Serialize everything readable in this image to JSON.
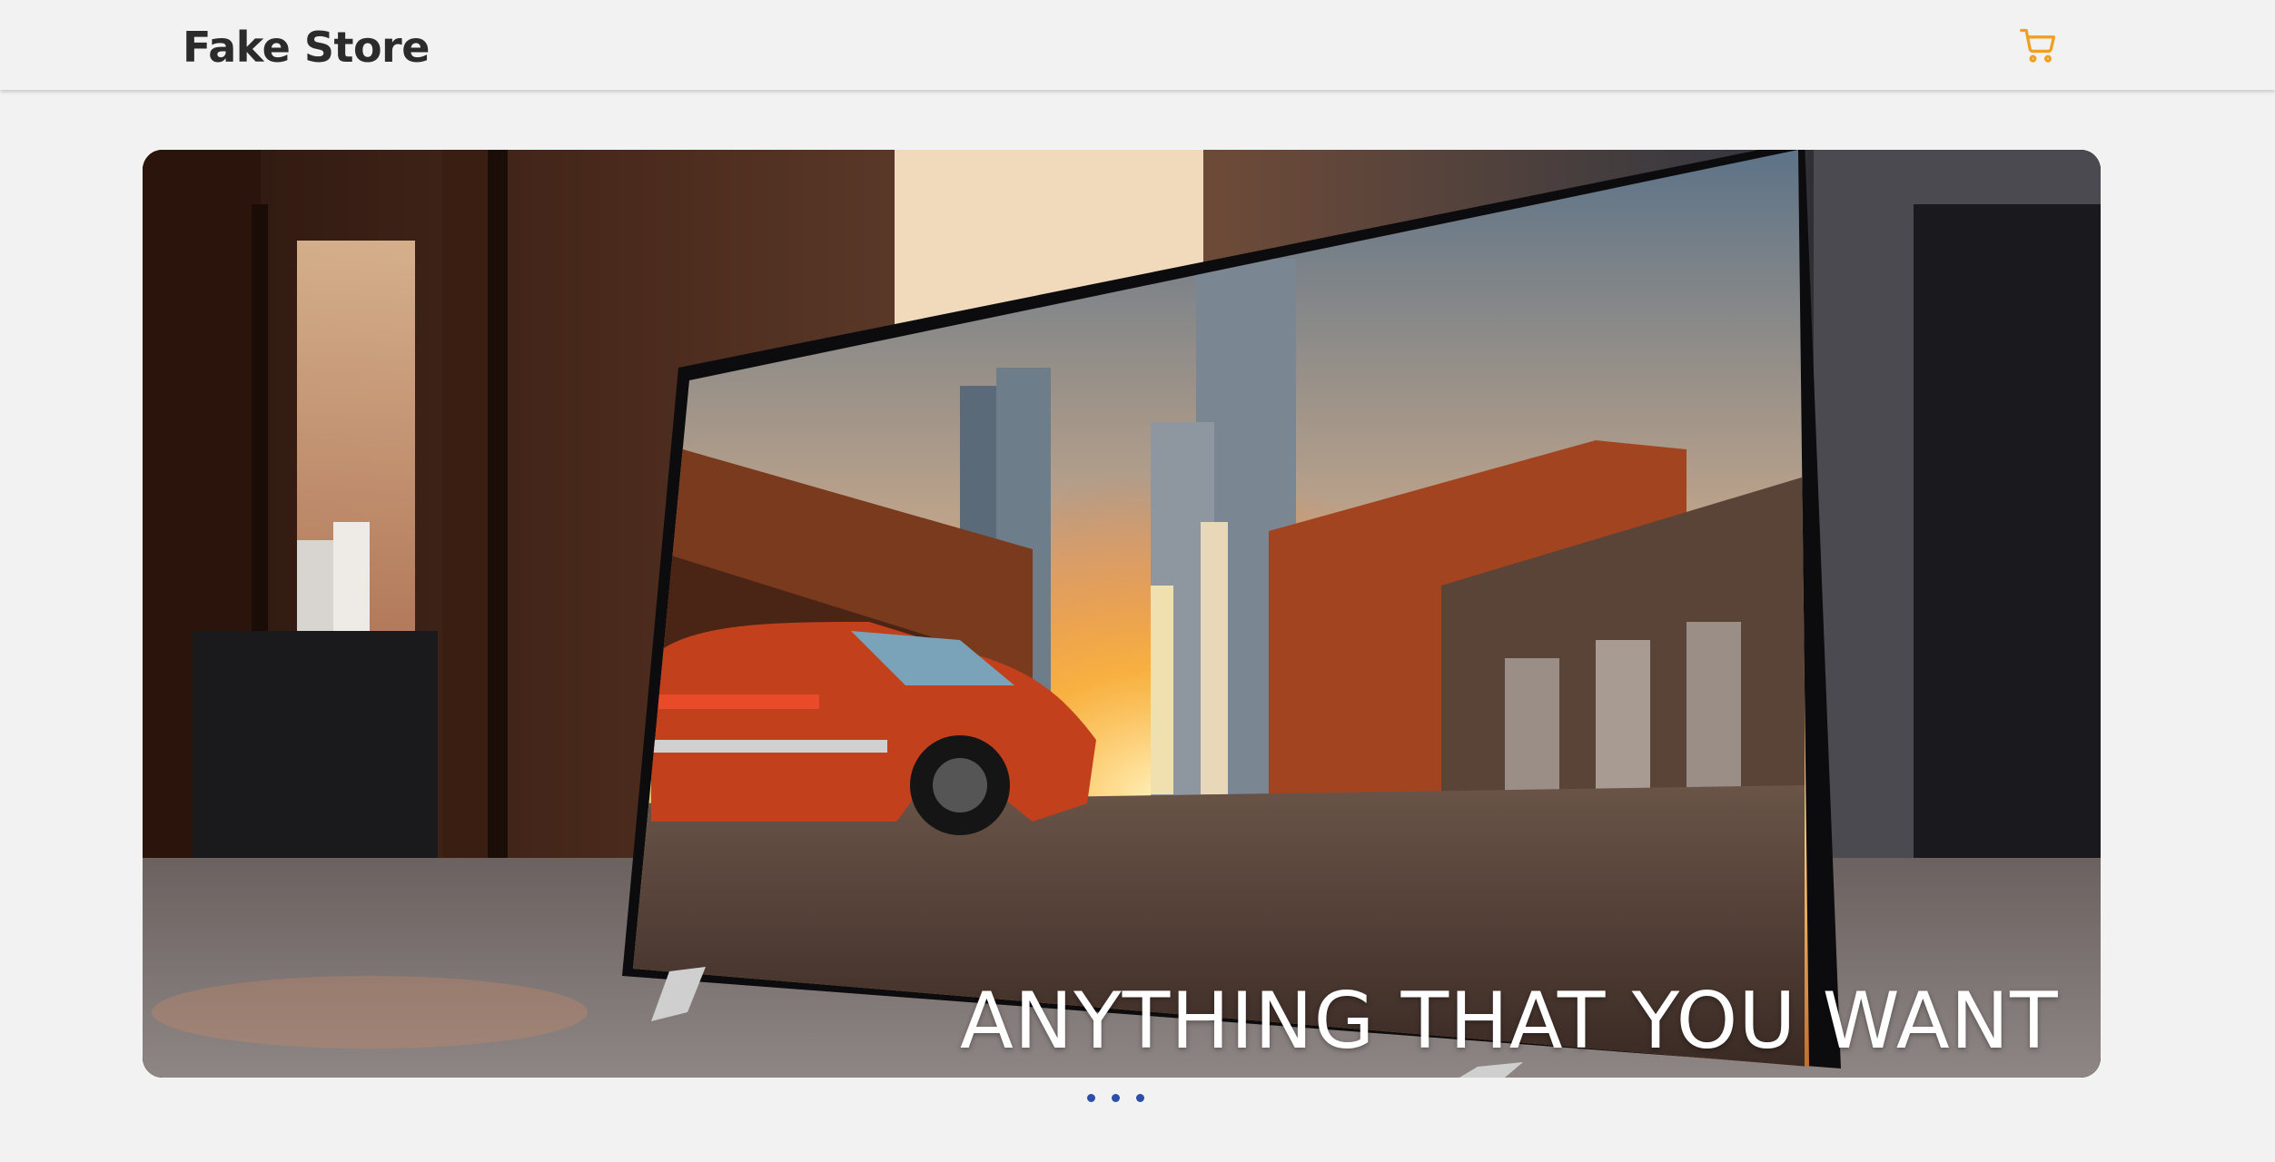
{
  "navbar": {
    "brand": "Fake Store",
    "cart_icon": "shopping-cart-icon",
    "cart_color": "#f0a020"
  },
  "hero": {
    "caption": "ANYTHING THAT YOU WANT",
    "image_alt": "tv-street-scene"
  },
  "carousel": {
    "indicators": [
      "slide-1",
      "slide-2",
      "slide-3"
    ],
    "indicator_color": "#2b4fa8"
  }
}
